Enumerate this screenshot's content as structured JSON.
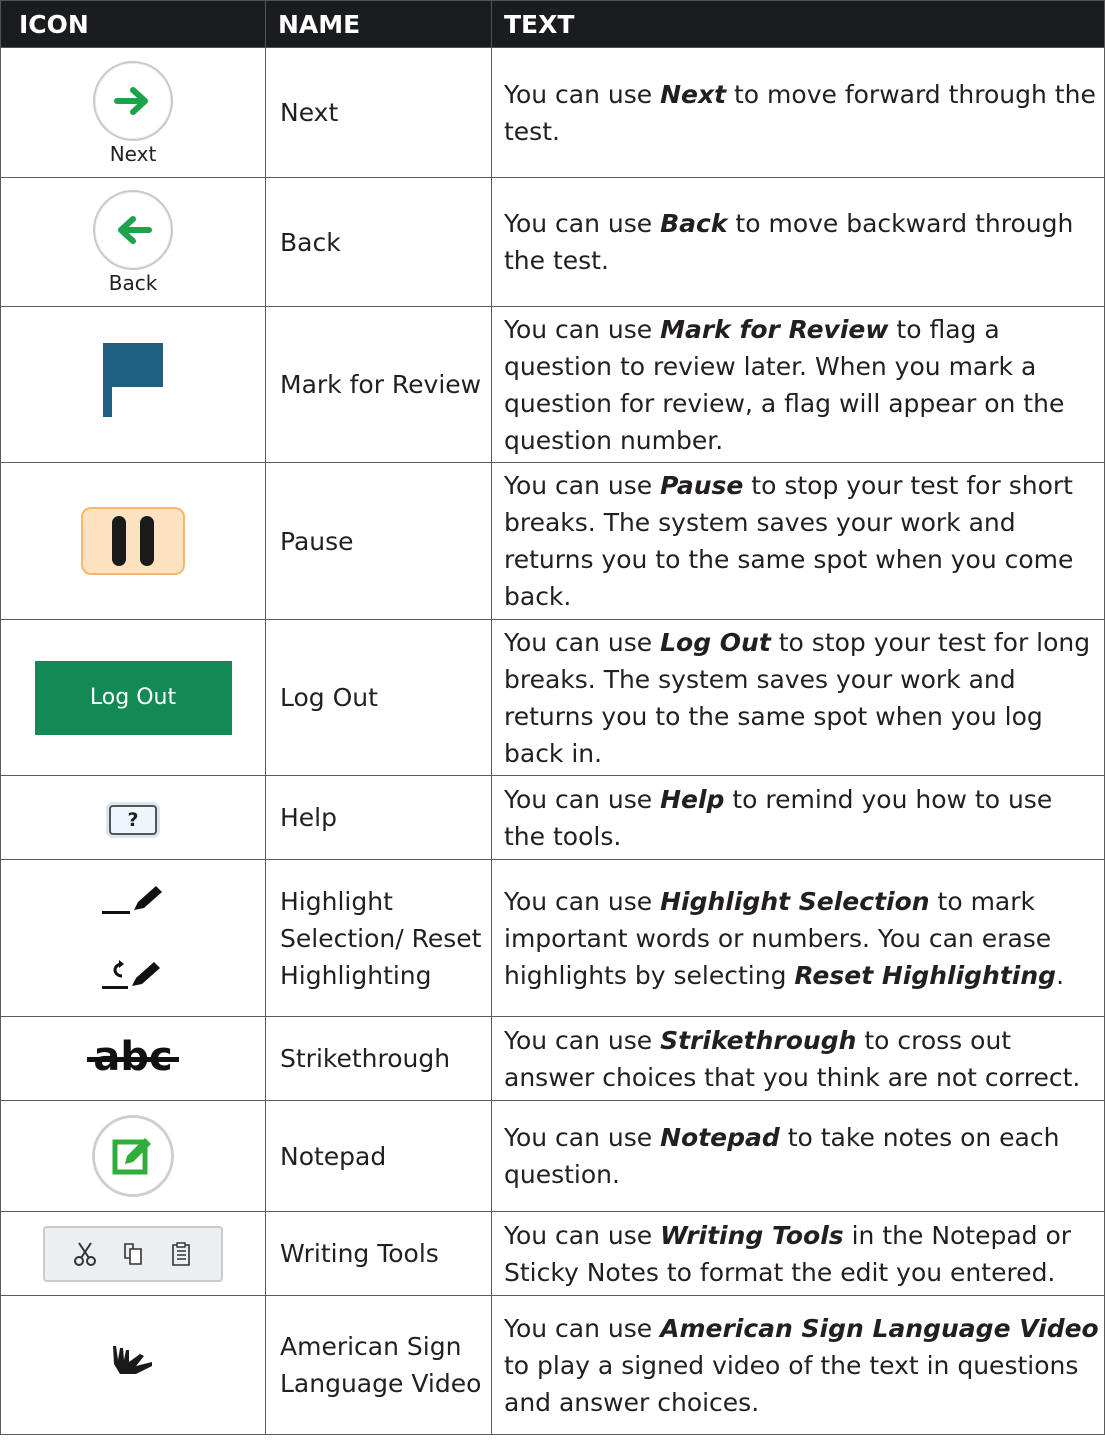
{
  "headers": {
    "icon": "ICON",
    "name": "NAME",
    "text": "TEXT"
  },
  "colors": {
    "header_bg": "#1b1c20",
    "arrow_green": "#1ea24a",
    "flag_blue": "#1f5f82",
    "pause_bg": "#fde2c2",
    "logout_green": "#138a56",
    "notepad_green": "#2fae3c"
  },
  "rows": [
    {
      "icon": "next-arrow-icon",
      "icon_label": "Next",
      "name": "Next",
      "text": [
        "You can use ",
        {
          "b": "Next"
        },
        " to move forward through the test."
      ]
    },
    {
      "icon": "back-arrow-icon",
      "icon_label": "Back",
      "name": "Back",
      "text": [
        "You can use ",
        {
          "b": "Back"
        },
        " to move backward through the test."
      ]
    },
    {
      "icon": "flag-icon",
      "name": "Mark for Review",
      "text": [
        "You can use ",
        {
          "b": "Mark for Review"
        },
        " to flag a question to review later. When you mark a question for review, a flag will appear on the question number."
      ]
    },
    {
      "icon": "pause-icon",
      "name": "Pause",
      "text": [
        "You can use ",
        {
          "b": "Pause"
        },
        " to stop your test for short breaks. The system saves your work and returns you to the same spot when you come back."
      ]
    },
    {
      "icon": "logout-button-icon",
      "icon_label": "Log Out",
      "name": "Log Out",
      "text": [
        "You can use ",
        {
          "b": "Log Out"
        },
        " to stop your test for long breaks. The system saves your work and returns you to the same spot when you log back in."
      ]
    },
    {
      "icon": "help-icon",
      "icon_label": "?",
      "name": "Help",
      "text": [
        "You can use ",
        {
          "b": "Help"
        },
        " to remind you how to use the tools."
      ]
    },
    {
      "icon": "highlight-icon",
      "name": "Highlight Selection/ Reset Highlighting",
      "text": [
        "You can use ",
        {
          "b": "Highlight Selection"
        },
        " to mark important words or numbers. You can erase highlights by selecting ",
        {
          "b": "Reset Highlighting"
        },
        "."
      ]
    },
    {
      "icon": "strikethrough-icon",
      "icon_label": "abc",
      "name": "Strikethrough",
      "text": [
        "You can use ",
        {
          "b": "Strikethrough"
        },
        " to cross out answer choices that you think are not correct."
      ]
    },
    {
      "icon": "notepad-icon",
      "name": "Notepad",
      "text": [
        "You can use ",
        {
          "b": "Notepad"
        },
        " to take notes on each question."
      ]
    },
    {
      "icon": "writing-tools-icon",
      "name": "Writing Tools",
      "text": [
        "You can use ",
        {
          "b": "Writing Tools"
        },
        " in the Notepad or Sticky Notes to format the edit you entered."
      ]
    },
    {
      "icon": "sign-language-hand-icon",
      "name": "American Sign Language Video",
      "text": [
        "You can use ",
        {
          "b": "American Sign Language Video"
        },
        " to play a signed video of the text in questions and answer choices."
      ]
    }
  ]
}
